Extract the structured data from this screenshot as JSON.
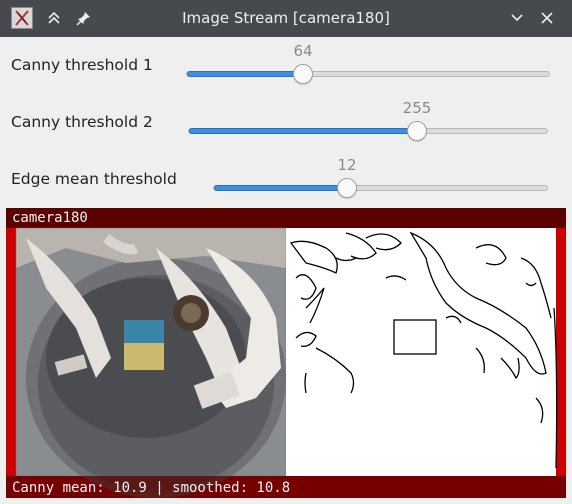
{
  "window": {
    "title": "Image Stream [camera180]",
    "icons": [
      "app-logo-icon",
      "keep-above-icon",
      "pin-icon",
      "minimize-icon",
      "close-icon"
    ]
  },
  "sliders": [
    {
      "label": "Canny threshold 1",
      "value": "64",
      "fraction": 0.32
    },
    {
      "label": "Canny threshold 2",
      "value": "255",
      "fraction": 0.63
    },
    {
      "label": "Edge mean threshold",
      "value": "12",
      "fraction": 0.4
    }
  ],
  "image": {
    "camera_label": "camera180",
    "status_text": "Canny mean: 10.9 | smoothed: 10.8",
    "frame_color": "#cc0000"
  }
}
